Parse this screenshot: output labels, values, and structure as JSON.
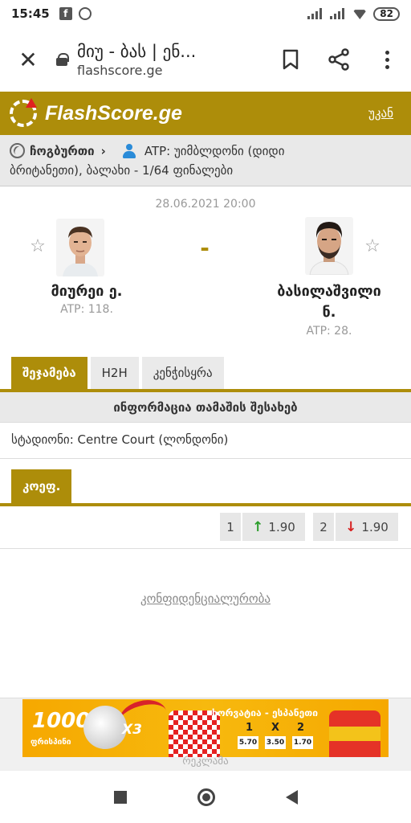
{
  "status_bar": {
    "time": "15:45",
    "battery": "82"
  },
  "browser": {
    "tab_title": "მიუ - ბას | ენ...",
    "url": "flashscore.ge"
  },
  "site": {
    "brand": "FlashScore.ge",
    "back_label": "უკან"
  },
  "breadcrumb": {
    "country": "ჩოგბურთი",
    "tournament_line1": "ATP: უიმბლდონი (დიდი",
    "tournament_line2": "ბრიტანეთი), ბალახი - 1/64 ფინალები"
  },
  "match": {
    "datetime": "28.06.2021 20:00",
    "score_separator": "-",
    "home": {
      "name": "მიურეი ე.",
      "rank": "ATP: 118."
    },
    "away": {
      "name_line1": "ბასილაშვილი",
      "name_line2": "ნ.",
      "rank": "ATP: 28."
    }
  },
  "tabs": [
    {
      "label": "შეჯამება",
      "active": true
    },
    {
      "label": "H2H",
      "active": false
    },
    {
      "label": "კენჭისყრა",
      "active": false
    }
  ],
  "info": {
    "heading": "ინფორმაცია თამაშის შესახებ",
    "venue": "სტადიონი: Centre Court (ლონდონი)"
  },
  "odds": {
    "tab_label": "კოეფ.",
    "items": [
      {
        "label": "1",
        "value": "1.90",
        "trend": "up"
      },
      {
        "label": "2",
        "value": "1.90",
        "trend": "down"
      }
    ]
  },
  "privacy_link": "კონფიდენციალურობა",
  "ad": {
    "amount": "1000",
    "currency": "ფრისპინი",
    "multiplier": "X3",
    "title": "ხორვატია - ესპანეთი",
    "headers": [
      "1",
      "X",
      "2"
    ],
    "odds": [
      "5.70",
      "3.50",
      "1.70"
    ],
    "label": "რეკლამა"
  },
  "colors": {
    "brand": "#ad8d0a",
    "up": "#2a9d2a",
    "down": "#d82020"
  }
}
